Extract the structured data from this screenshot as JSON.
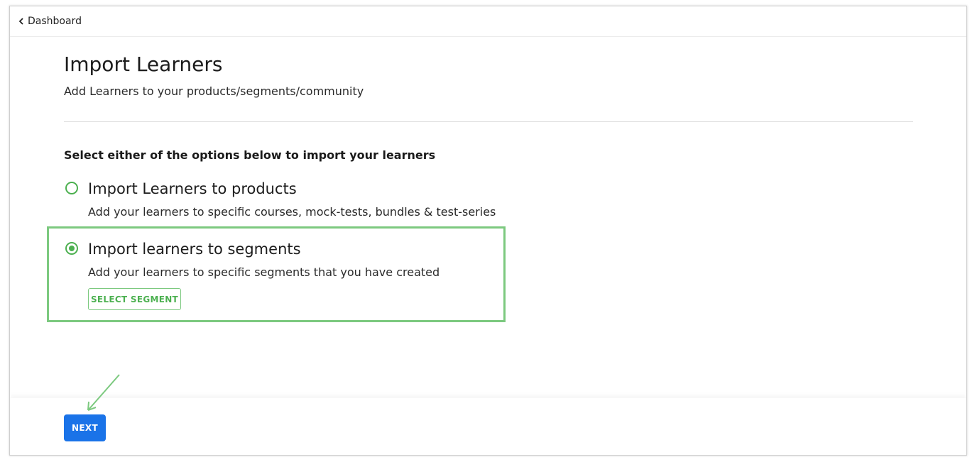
{
  "breadcrumb": {
    "back_label": "Dashboard"
  },
  "header": {
    "title": "Import Learners",
    "subtitle": "Add Learners to your products/segments/community"
  },
  "instruction": "Select either of the options below to import your learners",
  "options": [
    {
      "label": "Import Learners to products",
      "description": "Add your learners to specific courses, mock-tests, bundles & test-series",
      "selected": false
    },
    {
      "label": "Import learners to segments",
      "description": "Add your learners to specific segments that you have created",
      "selected": true,
      "action_label": "SELECT SEGMENT"
    }
  ],
  "footer": {
    "next_label": "NEXT"
  },
  "colors": {
    "accent_green": "#4cb050",
    "highlight_green": "#7cc97f",
    "primary_blue": "#1a73e8"
  },
  "icons": {
    "back": "chevron-left-icon",
    "annotation": "arrow-annotation-icon"
  }
}
